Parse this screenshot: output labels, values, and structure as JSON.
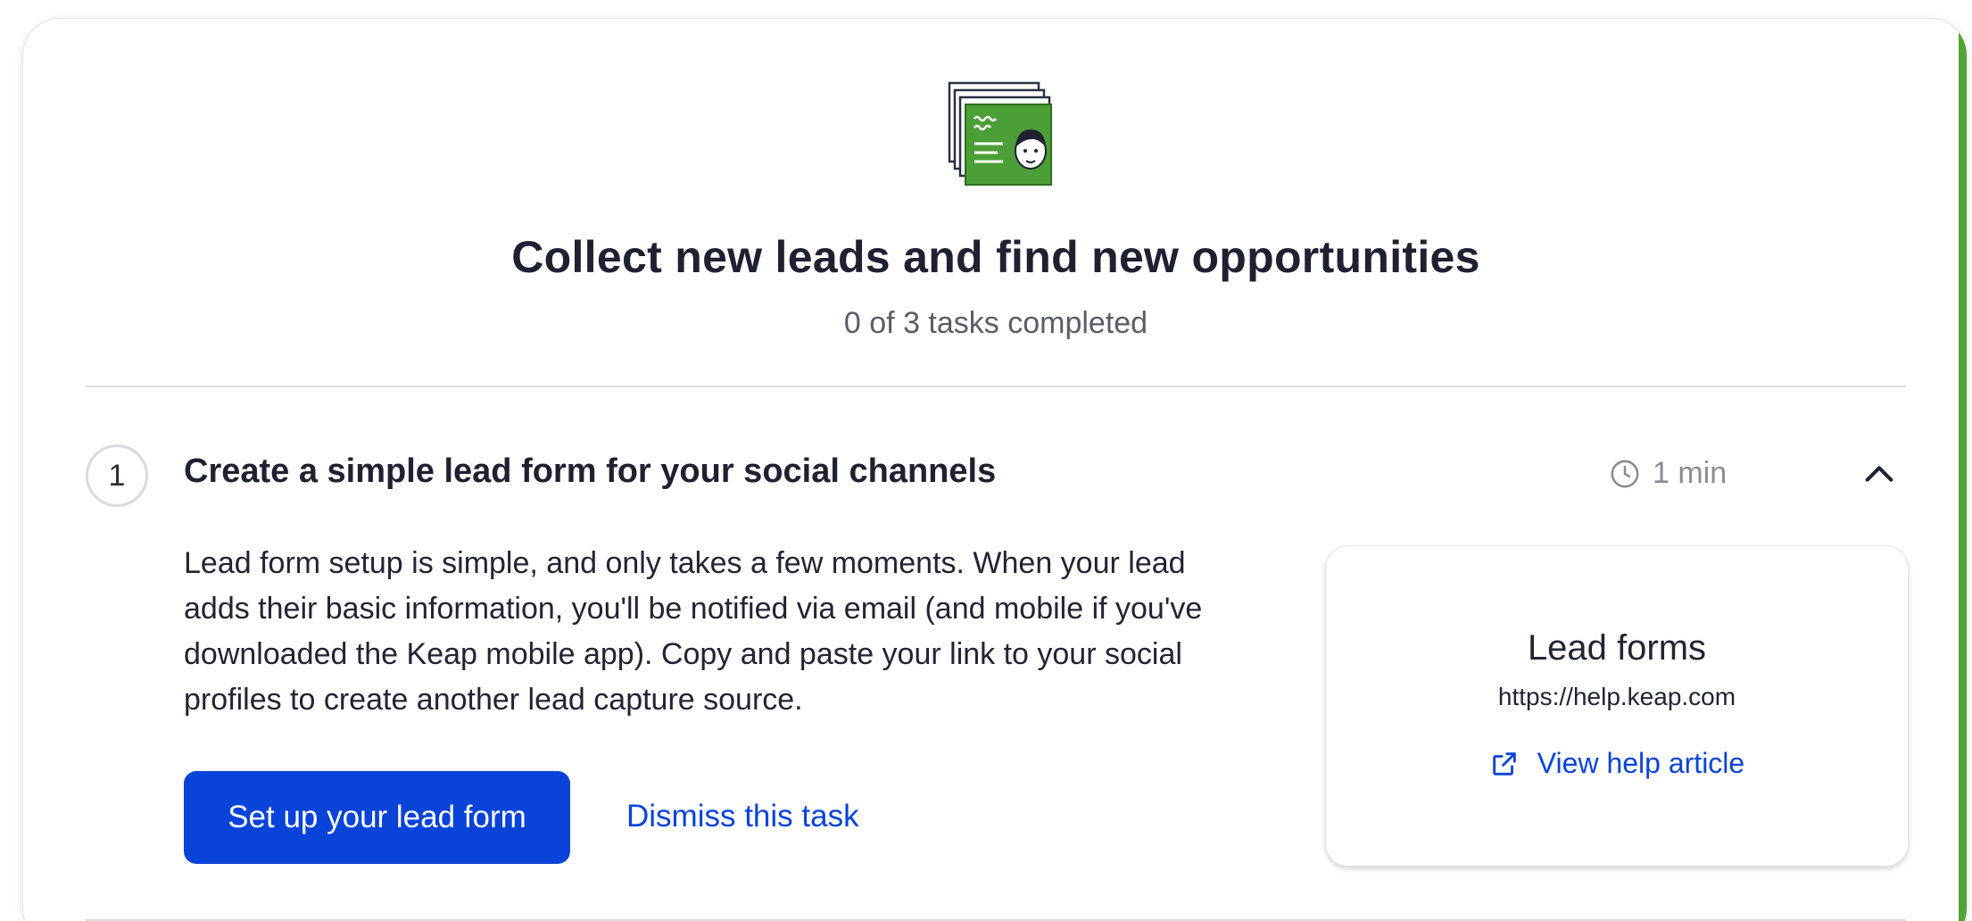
{
  "header": {
    "illustration_icon": "lead-form-id-card-icon",
    "title": "Collect new leads and find new opportunities",
    "progress": "0 of 3 tasks completed"
  },
  "task": {
    "number": "1",
    "title": "Create a simple lead form for your social channels",
    "duration": "1 min",
    "description": "Lead form setup is simple, and only takes a few moments. When your lead adds their basic information, you'll be notified via email (and mobile if you've downloaded the Keap mobile app). Copy and paste your link to your social profiles to create another lead capture source.",
    "primary_action": "Set up your lead form",
    "dismiss_action": "Dismiss this task",
    "expanded": true
  },
  "help_card": {
    "title": "Lead forms",
    "url": "https://help.keap.com",
    "link_label": "View help article",
    "link_icon": "external-link-icon"
  },
  "colors": {
    "primary": "#0a43d8",
    "accent_green": "#52a535",
    "heading": "#1f2130",
    "muted": "#8a8c94"
  }
}
